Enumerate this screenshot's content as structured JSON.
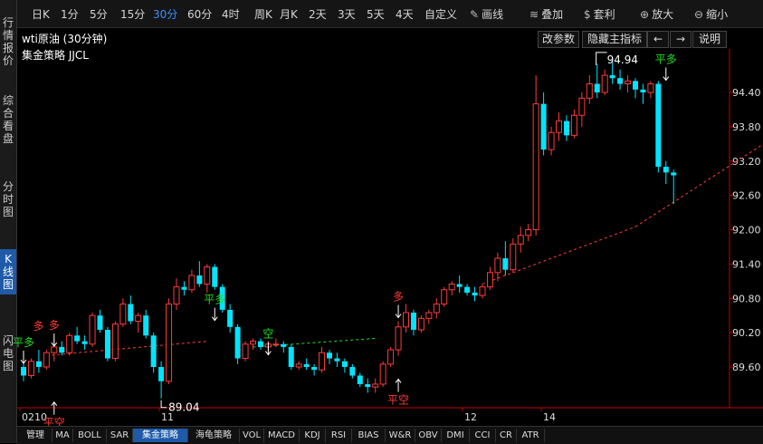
{
  "sidebar": {
    "tabs": [
      {
        "label": "行情报价",
        "active": false
      },
      {
        "label": "综合看盘",
        "active": false
      },
      {
        "label": "分时图",
        "active": false
      },
      {
        "label": "K线图",
        "active": true
      },
      {
        "label": "闪电图",
        "active": false
      }
    ]
  },
  "toolbar": {
    "periods": [
      "日K",
      "1分",
      "5分",
      "15分",
      "30分",
      "60分",
      "4时",
      "周K",
      "月K",
      "2天",
      "3天",
      "5天",
      "4天",
      "自定义"
    ],
    "active_period": "30分",
    "tools": [
      {
        "label": "画线",
        "icon": "pencil-icon"
      },
      {
        "label": "叠加",
        "icon": "stack-icon"
      },
      {
        "label": "套利",
        "icon": "moneybag-icon"
      },
      {
        "label": "放大",
        "icon": "zoom-in-icon"
      },
      {
        "label": "缩小",
        "icon": "zoom-out-icon"
      }
    ]
  },
  "header": {
    "title": "wti原油 (30分钟)",
    "strategy": "集金策略 JJCL",
    "buttons": {
      "params": "改参数",
      "hide": "隐藏主指标",
      "left": "←",
      "right": "→",
      "help": "说明"
    }
  },
  "bottom_tabs": [
    "管理",
    "MA",
    "BOLL",
    "SAR",
    "集金策略",
    "海龟策略",
    "VOL",
    "MACD",
    "KDJ",
    "RSI",
    "BIAS",
    "W&R",
    "OBV",
    "DMI",
    "CCI",
    "CR",
    "ATR"
  ],
  "active_bottom_tab": "集金策略",
  "colors": {
    "up": "#ff3b3b",
    "down": "#00e5ff",
    "buy": "#ff3b3b",
    "sell": "#22dd22",
    "axis": "#c00000"
  },
  "chart_data": {
    "type": "candlestick",
    "y_ticks": [
      "94.40",
      "93.80",
      "93.20",
      "92.60",
      "92.00",
      "91.40",
      "90.80",
      "90.20",
      "89.60"
    ],
    "x_labels": [
      "0210",
      "11",
      "12",
      "14"
    ],
    "annotations": {
      "high": "94.94",
      "low": "89.04"
    },
    "signals": [
      "平多",
      "多",
      "平空",
      "平多",
      "空",
      "多",
      "平空",
      "平多"
    ],
    "candles": [
      [
        89.6,
        89.7,
        89.35,
        89.45
      ],
      [
        89.45,
        89.75,
        89.4,
        89.7
      ],
      [
        89.7,
        89.9,
        89.5,
        89.6
      ],
      [
        89.6,
        89.9,
        89.55,
        89.85
      ],
      [
        89.85,
        90.1,
        89.7,
        89.95
      ],
      [
        89.95,
        90.05,
        89.8,
        89.85
      ],
      [
        89.85,
        90.2,
        89.8,
        90.15
      ],
      [
        90.15,
        90.3,
        90.0,
        90.05
      ],
      [
        90.05,
        90.15,
        89.9,
        90.0
      ],
      [
        90.0,
        90.55,
        89.95,
        90.5
      ],
      [
        90.5,
        90.6,
        90.2,
        90.25
      ],
      [
        90.25,
        90.3,
        89.7,
        89.75
      ],
      [
        89.75,
        90.4,
        89.7,
        90.35
      ],
      [
        90.35,
        90.8,
        90.3,
        90.7
      ],
      [
        90.7,
        90.85,
        90.35,
        90.4
      ],
      [
        90.4,
        90.55,
        90.2,
        90.5
      ],
      [
        90.5,
        90.6,
        90.1,
        90.15
      ],
      [
        90.15,
        90.2,
        89.5,
        89.6
      ],
      [
        89.6,
        89.7,
        89.05,
        89.35
      ],
      [
        89.35,
        90.8,
        89.3,
        90.7
      ],
      [
        90.7,
        91.15,
        90.6,
        91.0
      ],
      [
        91.0,
        91.1,
        90.85,
        90.95
      ],
      [
        90.95,
        91.3,
        90.9,
        91.2
      ],
      [
        91.2,
        91.45,
        91.0,
        91.05
      ],
      [
        91.05,
        91.4,
        90.9,
        91.35
      ],
      [
        91.35,
        91.4,
        90.95,
        91.0
      ],
      [
        91.0,
        91.05,
        90.55,
        90.6
      ],
      [
        90.6,
        90.7,
        90.2,
        90.3
      ],
      [
        90.3,
        90.35,
        89.65,
        89.75
      ],
      [
        89.75,
        90.05,
        89.7,
        90.0
      ],
      [
        90.0,
        90.1,
        89.9,
        90.05
      ],
      [
        90.05,
        90.1,
        89.9,
        89.95
      ],
      [
        89.95,
        90.05,
        89.8,
        90.0
      ],
      [
        90.0,
        90.1,
        89.95,
        90.0
      ],
      [
        90.0,
        90.05,
        89.85,
        89.95
      ],
      [
        89.95,
        90.0,
        89.55,
        89.6
      ],
      [
        89.6,
        89.7,
        89.55,
        89.65
      ],
      [
        89.65,
        89.75,
        89.55,
        89.6
      ],
      [
        89.6,
        89.65,
        89.45,
        89.55
      ],
      [
        89.55,
        89.95,
        89.5,
        89.85
      ],
      [
        89.85,
        89.9,
        89.65,
        89.75
      ],
      [
        89.75,
        89.85,
        89.6,
        89.7
      ],
      [
        89.7,
        89.75,
        89.5,
        89.6
      ],
      [
        89.6,
        89.65,
        89.4,
        89.45
      ],
      [
        89.45,
        89.5,
        89.25,
        89.3
      ],
      [
        89.3,
        89.4,
        89.15,
        89.25
      ],
      [
        89.25,
        89.4,
        89.15,
        89.3
      ],
      [
        89.3,
        89.7,
        89.25,
        89.65
      ],
      [
        89.65,
        89.95,
        89.6,
        89.9
      ],
      [
        89.9,
        90.4,
        89.8,
        90.3
      ],
      [
        90.3,
        90.7,
        90.2,
        90.55
      ],
      [
        90.55,
        90.6,
        90.15,
        90.25
      ],
      [
        90.25,
        90.5,
        90.2,
        90.45
      ],
      [
        90.45,
        90.6,
        90.35,
        90.55
      ],
      [
        90.55,
        90.8,
        90.45,
        90.7
      ],
      [
        90.7,
        91.0,
        90.65,
        90.95
      ],
      [
        90.95,
        91.1,
        90.85,
        91.05
      ],
      [
        91.05,
        91.2,
        90.9,
        91.0
      ],
      [
        91.0,
        91.05,
        90.85,
        90.9
      ],
      [
        90.9,
        91.0,
        90.75,
        90.85
      ],
      [
        90.85,
        91.05,
        90.8,
        91.0
      ],
      [
        91.0,
        91.35,
        90.95,
        91.25
      ],
      [
        91.25,
        91.6,
        91.1,
        91.5
      ],
      [
        91.5,
        91.8,
        91.2,
        91.3
      ],
      [
        91.3,
        91.85,
        91.25,
        91.75
      ],
      [
        91.75,
        92.05,
        91.6,
        91.9
      ],
      [
        91.9,
        92.1,
        91.8,
        92.0
      ],
      [
        92.0,
        94.7,
        91.9,
        94.2
      ],
      [
        94.2,
        94.4,
        93.3,
        93.4
      ],
      [
        93.4,
        93.8,
        93.3,
        93.7
      ],
      [
        93.7,
        94.05,
        93.55,
        93.9
      ],
      [
        93.9,
        94.0,
        93.55,
        93.65
      ],
      [
        93.65,
        94.1,
        93.6,
        94.0
      ],
      [
        94.0,
        94.4,
        93.8,
        94.3
      ],
      [
        94.3,
        94.7,
        94.2,
        94.55
      ],
      [
        94.55,
        94.9,
        94.3,
        94.4
      ],
      [
        94.4,
        94.8,
        94.35,
        94.7
      ],
      [
        94.7,
        94.94,
        94.55,
        94.65
      ],
      [
        94.65,
        94.8,
        94.45,
        94.55
      ],
      [
        94.55,
        94.7,
        94.4,
        94.6
      ],
      [
        94.6,
        94.65,
        94.3,
        94.45
      ],
      [
        94.45,
        94.55,
        94.2,
        94.4
      ],
      [
        94.4,
        94.6,
        94.3,
        94.55
      ],
      [
        94.55,
        94.6,
        93.0,
        93.1
      ],
      [
        93.1,
        93.2,
        92.8,
        93.0
      ],
      [
        93.0,
        93.05,
        92.45,
        92.95
      ]
    ]
  }
}
